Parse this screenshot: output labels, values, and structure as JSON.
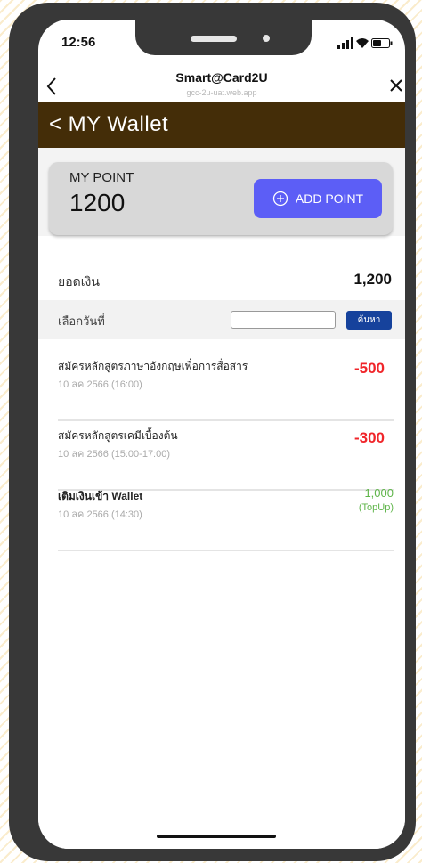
{
  "status_bar": {
    "time": "12:56"
  },
  "browser": {
    "title": "Smart@Card2U",
    "url": "gcc-2u-uat.web.app"
  },
  "header": {
    "title": "< MY Wallet"
  },
  "points": {
    "label": "MY POINT",
    "value": "1200",
    "add_button_label": "ADD POINT"
  },
  "balance": {
    "label": "ยอดเงิน",
    "value": "1,200"
  },
  "date_filter": {
    "label": "เลือกวันที่",
    "input_value": "",
    "search_label": "ค้นหา"
  },
  "transactions": [
    {
      "title": "สมัครหลักสูตรภาษาอังกฤษเพื่อการสื่อสาร",
      "date": "10 ลค 2566 (16:00)",
      "amount": "-500"
    },
    {
      "title": "สมัครหลักสูตรเคมีเบื้องต้น",
      "date": "10 ลค 2566 (15:00-17:00)",
      "amount": "-300"
    },
    {
      "title": "เติมเงินเข้า Wallet",
      "date": "10 ลค 2566 (14:30)",
      "amount": "1,000",
      "tag": "(TopUp)"
    }
  ],
  "colors": {
    "header_bg": "#442d08",
    "accent_button": "#5c5ef6",
    "search_button": "#16429c",
    "negative": "#f0252a",
    "positive": "#5fb54a"
  },
  "icons": [
    "signal-icon",
    "wifi-icon",
    "battery-icon",
    "back-chevron-icon",
    "close-icon",
    "plus-circle-icon",
    "calendar-icon"
  ]
}
